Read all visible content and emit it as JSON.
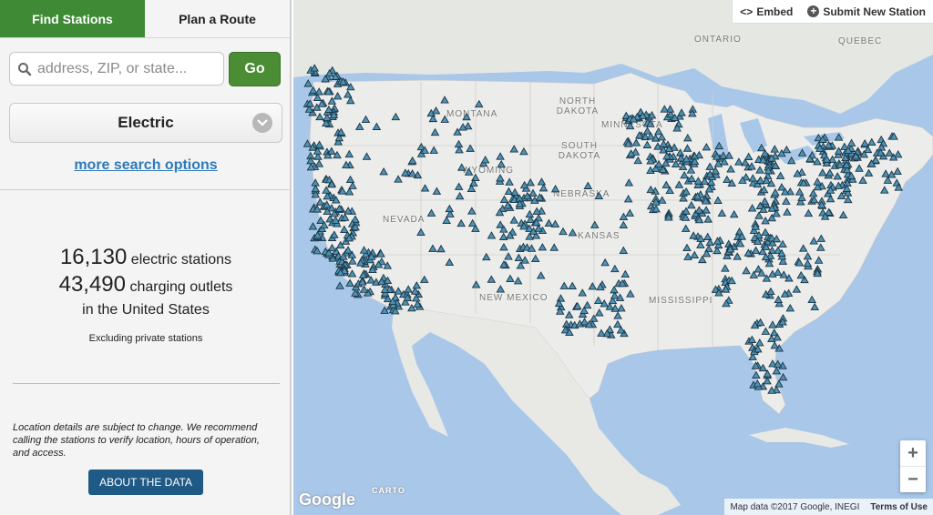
{
  "tabs": {
    "find": "Find Stations",
    "route": "Plan a Route"
  },
  "search": {
    "placeholder": "address, ZIP, or state...",
    "value": "",
    "go_label": "Go"
  },
  "fuel": {
    "selected": "Electric"
  },
  "more_options": "more search options",
  "stats": {
    "stations_count": "16,130",
    "stations_label": " electric stations",
    "outlets_count": "43,490",
    "outlets_label": " charging outlets",
    "region": "in the United States",
    "note": "Excluding private stations"
  },
  "disclaimer": "Location details are subject to change. We recommend calling the stations to verify location, hours of operation, and access.",
  "about_label": "ABOUT THE DATA",
  "map": {
    "embed": "Embed",
    "submit": "Submit New Station",
    "labels": [
      "ONTARIO",
      "QUEBEC",
      "NORTH DAKOTA",
      "SOUTH DAKOTA",
      "MONTANA",
      "WYOMING",
      "NEBRASKA",
      "KANSAS",
      "NEVADA",
      "NEW MEXICO",
      "MISSISSIPPI",
      "MINNESOTA"
    ],
    "attribution": "Map data ©2017 Google, INEGI",
    "terms": "Terms of Use",
    "google": "Google",
    "carto": "CARTO",
    "zoom_in": "+",
    "zoom_out": "−",
    "colors": {
      "water": "#a9c7e8",
      "land": "#ececea",
      "marker": "#4d92b4",
      "marker_outline": "#1c3342"
    }
  }
}
